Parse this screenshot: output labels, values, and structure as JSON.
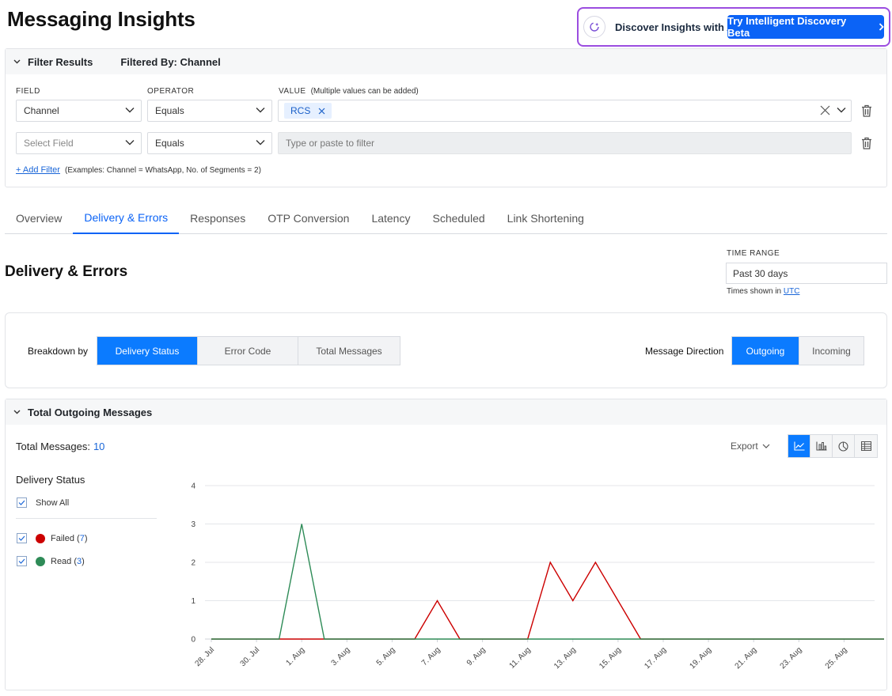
{
  "page": {
    "title": "Messaging Insights"
  },
  "ai_banner": {
    "text": "Discover Insights with AI",
    "button_label": "Try Intelligent Discovery Beta"
  },
  "filter": {
    "header": "Filter Results",
    "filtered_by": "Filtered By: Channel",
    "field_label": "FIELD",
    "operator_label": "OPERATOR",
    "value_label": "VALUE",
    "value_hint": "(Multiple values can be added)",
    "rows": [
      {
        "field": "Channel",
        "operator": "Equals",
        "chip": "RCS"
      },
      {
        "field": "Select Field",
        "operator": "Equals",
        "value_placeholder": "Type or paste to filter"
      }
    ],
    "add_filter_label": "+ Add Filter",
    "add_filter_examples": "(Examples: Channel = WhatsApp, No. of Segments = 2)"
  },
  "tabs": [
    "Overview",
    "Delivery & Errors",
    "Responses",
    "OTP Conversion",
    "Latency",
    "Scheduled",
    "Link Shortening"
  ],
  "active_tab": "Delivery & Errors",
  "section": {
    "title": "Delivery & Errors"
  },
  "time_range": {
    "label": "TIME RANGE",
    "value": "Past 30 days",
    "note_prefix": "Times shown in",
    "note_link": "UTC"
  },
  "breakdown": {
    "label": "Breakdown by",
    "options": [
      "Delivery Status",
      "Error Code",
      "Total Messages"
    ],
    "selected": "Delivery Status",
    "direction_label": "Message Direction",
    "direction_options": [
      "Outgoing",
      "Incoming"
    ],
    "direction_selected": "Outgoing"
  },
  "chart_panel": {
    "header": "Total Outgoing Messages",
    "total_label": "Total Messages:",
    "total_value": "10",
    "export_label": "Export",
    "views": [
      "line-chart-icon",
      "bar-chart-icon",
      "pie-chart-icon",
      "table-icon"
    ],
    "selected_view": "line-chart-icon",
    "legend_title": "Delivery Status",
    "show_all_label": "Show All",
    "legend": [
      {
        "label": "Failed",
        "count": "7",
        "color": "#cc0000"
      },
      {
        "label": "Read",
        "count": "3",
        "color": "#2e8b57"
      }
    ]
  },
  "colors": {
    "accent": "#0b7bff",
    "failed": "#cc0000",
    "read": "#2e8b57"
  },
  "chart_data": {
    "type": "line",
    "x": [
      "28. Jul",
      "29. Jul",
      "30. Jul",
      "31. Jul",
      "1. Aug",
      "2. Aug",
      "3. Aug",
      "4. Aug",
      "5. Aug",
      "6. Aug",
      "7. Aug",
      "8. Aug",
      "9. Aug",
      "10. Aug",
      "11. Aug",
      "12. Aug",
      "13. Aug",
      "14. Aug",
      "15. Aug",
      "16. Aug",
      "17. Aug",
      "18. Aug",
      "19. Aug",
      "20. Aug",
      "21. Aug",
      "22. Aug",
      "23. Aug",
      "24. Aug",
      "25. Aug",
      "26. Aug",
      "27. Aug"
    ],
    "tick_labels": [
      "28. Jul",
      "30. Jul",
      "1. Aug",
      "3. Aug",
      "5. Aug",
      "7. Aug",
      "9. Aug",
      "11. Aug",
      "13. Aug",
      "15. Aug",
      "17. Aug",
      "19. Aug",
      "21. Aug",
      "23. Aug",
      "25. Aug"
    ],
    "y_ticks": [
      0,
      1,
      2,
      3,
      4
    ],
    "ylim": [
      0,
      4
    ],
    "grid": true,
    "series": [
      {
        "name": "Failed",
        "color": "#cc0000",
        "values": [
          0,
          0,
          0,
          0,
          0,
          0,
          0,
          0,
          0,
          0,
          1,
          0,
          0,
          0,
          0,
          2,
          1,
          2,
          1,
          0,
          0,
          0,
          0,
          0,
          0,
          0,
          0,
          0,
          0,
          0,
          0
        ]
      },
      {
        "name": "Read",
        "color": "#2e8b57",
        "values": [
          0,
          0,
          0,
          0,
          3,
          0,
          0,
          0,
          0,
          0,
          0,
          0,
          0,
          0,
          0,
          0,
          0,
          0,
          0,
          0,
          0,
          0,
          0,
          0,
          0,
          0,
          0,
          0,
          0,
          0,
          0
        ]
      }
    ]
  }
}
